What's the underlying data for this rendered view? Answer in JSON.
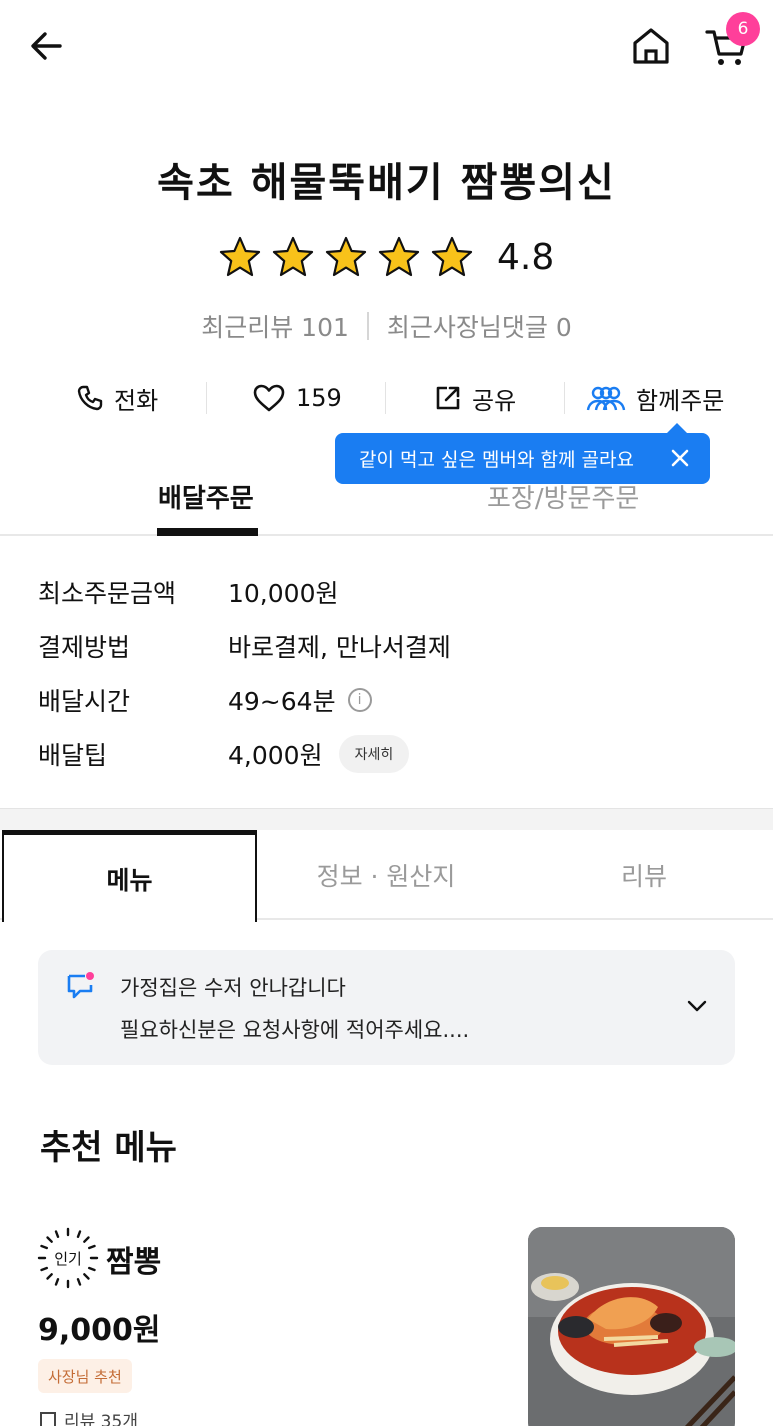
{
  "header": {
    "cart_count": "6",
    "icons": [
      "arrow-left-icon",
      "home-icon",
      "cart-icon"
    ]
  },
  "store": {
    "name": "속초 해물뚝배기 짬뽕의신",
    "rating": "4.8",
    "stars": 5,
    "recent_reviews": "최근리뷰 101",
    "recent_owner_replies": "최근사장님댓글 0"
  },
  "actions": {
    "call": "전화",
    "likes": "159",
    "share": "공유",
    "group_order": "함께주문"
  },
  "tooltip": {
    "text": "같이 먹고 싶은 멤버와 함께 골라요"
  },
  "order_tabs": [
    {
      "label": "배달주문",
      "active": true
    },
    {
      "label": "포장/방문주문",
      "active": false
    }
  ],
  "delivery_info": {
    "min_order_label": "최소주문금액",
    "min_order_value": "10,000원",
    "payment_label": "결제방법",
    "payment_value": "바로결제, 만나서결제",
    "time_label": "배달시간",
    "time_value": "49~64분",
    "time_info_glyph": "i",
    "tip_label": "배달팁",
    "tip_value": "4,000원",
    "tip_detail": "자세히"
  },
  "main_tabs": [
    {
      "label": "메뉴",
      "active": true
    },
    {
      "label": "정보 · 원산지",
      "active": false
    },
    {
      "label": "리뷰",
      "active": false
    }
  ],
  "notice": {
    "line1": "가정집은 수저 안나갑니다",
    "line2": "필요하신분은 요청사항에 적어주세요...."
  },
  "recommended": {
    "title": "추천 메뉴",
    "items": [
      {
        "badge": "인기",
        "name": "짬뽕",
        "price": "9,000원",
        "tag": "사장님 추천",
        "reviews": "리뷰 35개"
      }
    ]
  },
  "colors": {
    "accent_pink": "#ff3f9a",
    "tooltip_blue": "#1a7df2",
    "star_yellow": "#f8c21a",
    "owner_tag_text": "#c46c36",
    "owner_tag_bg": "#fdf0e6"
  }
}
